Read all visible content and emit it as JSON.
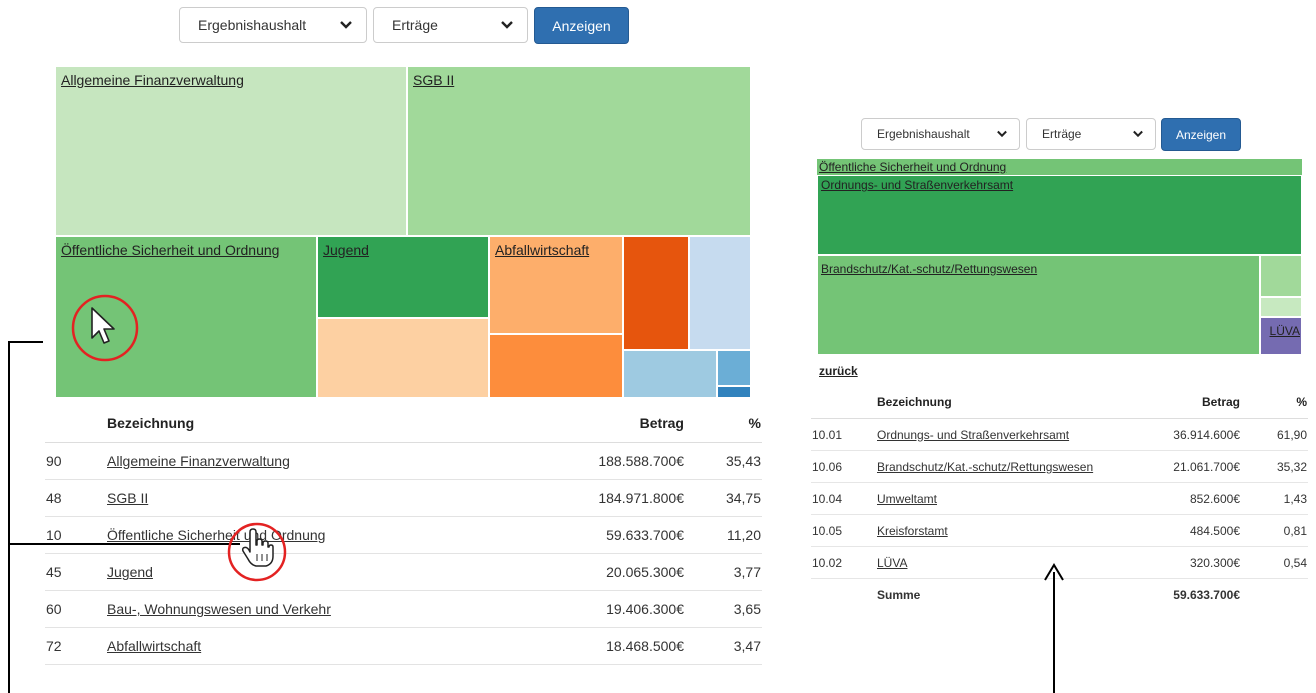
{
  "left": {
    "controls": {
      "budget_select": "Ergebnishaushalt",
      "type_select": "Erträge",
      "show_button": "Anzeigen"
    },
    "treemap": [
      {
        "label": "Allgemeine Finanzverwaltung",
        "color": "#c6e6bf"
      },
      {
        "label": "SGB II",
        "color": "#a1d99a"
      },
      {
        "label": "Öffentliche Sicherheit und Ordnung",
        "color": "#74c476"
      },
      {
        "label": "Jugend",
        "color": "#31a354"
      },
      {
        "label": "",
        "color": "#fdd0a2"
      },
      {
        "label": "Abfallwirtschaft",
        "color": "#fdae6b"
      },
      {
        "label": "",
        "color": "#fd8d3c"
      },
      {
        "label": "",
        "color": "#e6550d"
      },
      {
        "label": "",
        "color": "#c6dbef"
      },
      {
        "label": "",
        "color": "#9ecae1"
      },
      {
        "label": "",
        "color": "#6baed6"
      },
      {
        "label": "",
        "color": "#3182bd"
      }
    ],
    "table": {
      "headers": {
        "name": "Bezeichnung",
        "amount": "Betrag",
        "pct": "%"
      },
      "rows": [
        {
          "code": "90",
          "name": "Allgemeine Finanzverwaltung",
          "amount": "188.588.700€",
          "pct": "35,43"
        },
        {
          "code": "48",
          "name": "SGB II",
          "amount": "184.971.800€",
          "pct": "34,75"
        },
        {
          "code": "10",
          "name": "Öffentliche Sicherheit und Ordnung",
          "amount": "59.633.700€",
          "pct": "11,20"
        },
        {
          "code": "45",
          "name": "Jugend",
          "amount": "20.065.300€",
          "pct": "3,77"
        },
        {
          "code": "60",
          "name": "Bau-, Wohnungswesen und Verkehr",
          "amount": "19.406.300€",
          "pct": "3,65"
        },
        {
          "code": "72",
          "name": "Abfallwirtschaft",
          "amount": "18.468.500€",
          "pct": "3,47"
        }
      ]
    }
  },
  "right": {
    "controls": {
      "budget_select": "Ergebnishaushalt",
      "type_select": "Erträge",
      "show_button": "Anzeigen"
    },
    "treemap": {
      "parent_label": "Öffentliche Sicherheit und Ordnung",
      "parent_color": "#74c476",
      "tiles": [
        {
          "label": "Ordnungs- und Straßenverkehrsamt",
          "color": "#31a354"
        },
        {
          "label": "Brandschutz/Kat.-schutz/Rettungswesen",
          "color": "#74c476"
        },
        {
          "label": "",
          "color": "#a1d99a"
        },
        {
          "label": "",
          "color": "#c7e9c0"
        },
        {
          "label": "LÜVA",
          "color": "#756bb1"
        }
      ]
    },
    "back_link": "zurück",
    "table": {
      "headers": {
        "name": "Bezeichnung",
        "amount": "Betrag",
        "pct": "%"
      },
      "rows": [
        {
          "code": "10.01",
          "name": "Ordnungs- und Straßenverkehrsamt",
          "amount": "36.914.600€",
          "pct": "61,90"
        },
        {
          "code": "10.06",
          "name": "Brandschutz/Kat.-schutz/Rettungswesen",
          "amount": "21.061.700€",
          "pct": "35,32"
        },
        {
          "code": "10.04",
          "name": "Umweltamt",
          "amount": "852.600€",
          "pct": "1,43"
        },
        {
          "code": "10.05",
          "name": "Kreisforstamt",
          "amount": "484.500€",
          "pct": "0,81"
        },
        {
          "code": "10.02",
          "name": "LÜVA",
          "amount": "320.300€",
          "pct": "0,54"
        }
      ],
      "sum_label": "Summe",
      "sum_amount": "59.633.700€"
    }
  },
  "icons": [
    "chevron-down-icon",
    "arrow-cursor-icon",
    "hand-pointer-icon"
  ],
  "highlight_color": "#e32222"
}
